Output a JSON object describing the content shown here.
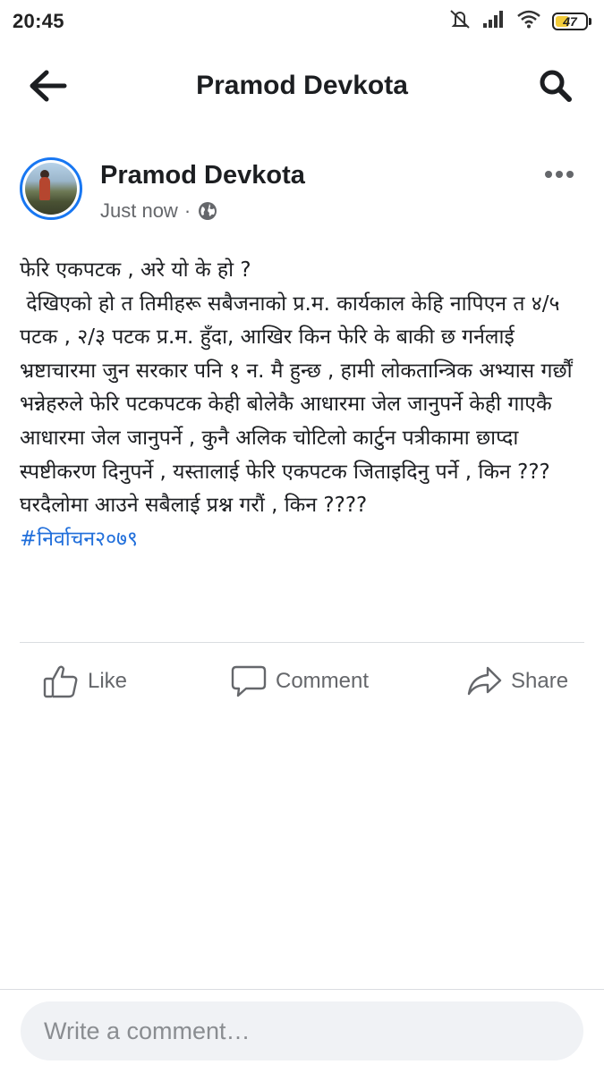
{
  "status_bar": {
    "time": "20:45",
    "battery": "47",
    "icons": [
      "mute-icon",
      "signal-icon",
      "wifi-icon",
      "battery-icon"
    ]
  },
  "header": {
    "title": "Pramod Devkota",
    "back_icon": "back-arrow-icon",
    "search_icon": "search-icon"
  },
  "post": {
    "author": "Pramod Devkota",
    "time": "Just now",
    "separator": "·",
    "privacy_icon": "globe-icon",
    "body": "फेरि एकपटक , अरे यो के हो ?\n देखिएको हो त तिमीहरू सबैजनाको प्र.म. कार्यकाल केहि नापिएन त ४/५ पटक , २/३ पटक प्र.म. हुँदा, आखिर किन फेरि के बाकी छ गर्नलाई भ्रष्टाचारमा जुन सरकार पनि १ न. मै हुन्छ , हामी लोकतान्त्रिक अभ्यास गर्छौं भन्नेहरुले फेरि पटकपटक केही बोलेकै आधारमा जेल जानुपर्ने केही गाएकै आधारमा जेल जानुपर्ने , कुनै अलिक चोटिलो कार्टुन पत्रीकामा छाप्दा स्पष्टीकरण दिनुपर्ने , यस्तालाई फेरि एकपटक जिताइदिनु पर्ने , किन ???\nघरदैलोमा आउने सबैलाई प्रश्न गरौं , किन ????",
    "hashtag": "#निर्वाचन२०७९"
  },
  "actions": {
    "like": "Like",
    "comment": "Comment",
    "share": "Share"
  },
  "comment_box": {
    "placeholder": "Write a comment…"
  },
  "colors": {
    "accent": "#1877f2",
    "hashtag": "#216fdb",
    "muted_text": "#65676b",
    "comment_bg": "#f0f2f5"
  }
}
